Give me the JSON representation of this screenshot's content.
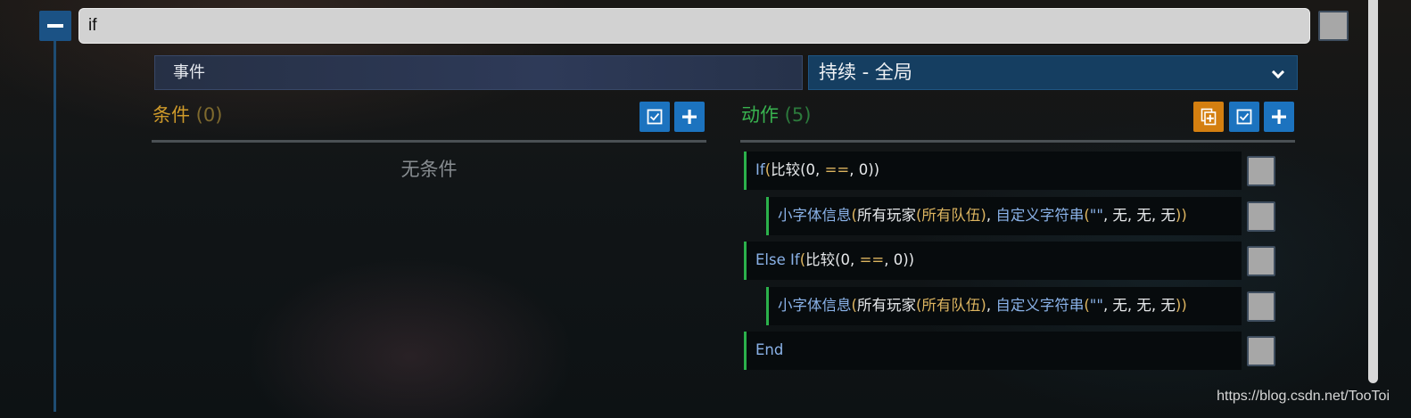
{
  "rule": {
    "title": "if"
  },
  "event": {
    "label": "事件",
    "type": "持续 - 全局"
  },
  "conditions": {
    "title": "条件",
    "count": " (0)",
    "empty_text": "无条件"
  },
  "actions": {
    "title": "动作",
    "count": " (5)",
    "rows": [
      {
        "indent": false,
        "parts": [
          {
            "t": "If",
            "c": "blue"
          },
          {
            "t": "(",
            "c": "gold"
          },
          {
            "t": "比较",
            "c": "white"
          },
          {
            "t": "(0, ",
            "c": "white"
          },
          {
            "t": "==",
            "c": "gold"
          },
          {
            "t": ", 0))",
            "c": "white"
          }
        ]
      },
      {
        "indent": true,
        "parts": [
          {
            "t": "小字体信息",
            "c": "blue"
          },
          {
            "t": "(",
            "c": "gold"
          },
          {
            "t": "所有玩家",
            "c": "white"
          },
          {
            "t": "(所有队伍)",
            "c": "gold"
          },
          {
            "t": ", ",
            "c": "white"
          },
          {
            "t": "自定义字符串",
            "c": "blue"
          },
          {
            "t": "(",
            "c": "gold"
          },
          {
            "t": "\"\"",
            "c": "blue"
          },
          {
            "t": ", 无, 无, 无",
            "c": "white"
          },
          {
            "t": "))",
            "c": "gold"
          }
        ]
      },
      {
        "indent": false,
        "parts": [
          {
            "t": "Else If",
            "c": "blue"
          },
          {
            "t": "(",
            "c": "gold"
          },
          {
            "t": "比较",
            "c": "white"
          },
          {
            "t": "(0, ",
            "c": "white"
          },
          {
            "t": "==",
            "c": "gold"
          },
          {
            "t": ", 0))",
            "c": "white"
          }
        ]
      },
      {
        "indent": true,
        "parts": [
          {
            "t": "小字体信息",
            "c": "blue"
          },
          {
            "t": "(",
            "c": "gold"
          },
          {
            "t": "所有玩家",
            "c": "white"
          },
          {
            "t": "(所有队伍)",
            "c": "gold"
          },
          {
            "t": ", ",
            "c": "white"
          },
          {
            "t": "自定义字符串",
            "c": "blue"
          },
          {
            "t": "(",
            "c": "gold"
          },
          {
            "t": "\"\"",
            "c": "blue"
          },
          {
            "t": ", 无, 无, 无",
            "c": "white"
          },
          {
            "t": "))",
            "c": "gold"
          }
        ]
      },
      {
        "indent": false,
        "parts": [
          {
            "t": "End",
            "c": "blue"
          }
        ]
      }
    ]
  },
  "icons": {
    "collapse": "minus-icon",
    "dropdown": "chevron-down-icon",
    "toggle_all": "checkbox-icon",
    "add": "plus-icon",
    "paste": "paste-icon"
  },
  "colors": {
    "accent_blue": "#1c73bf",
    "accent_orange": "#d47f10",
    "condition_title": "#cf9a2a",
    "action_title": "#38b24f",
    "action_bar": "#2bb14b"
  },
  "watermark": "https://blog.csdn.net/TooToi"
}
